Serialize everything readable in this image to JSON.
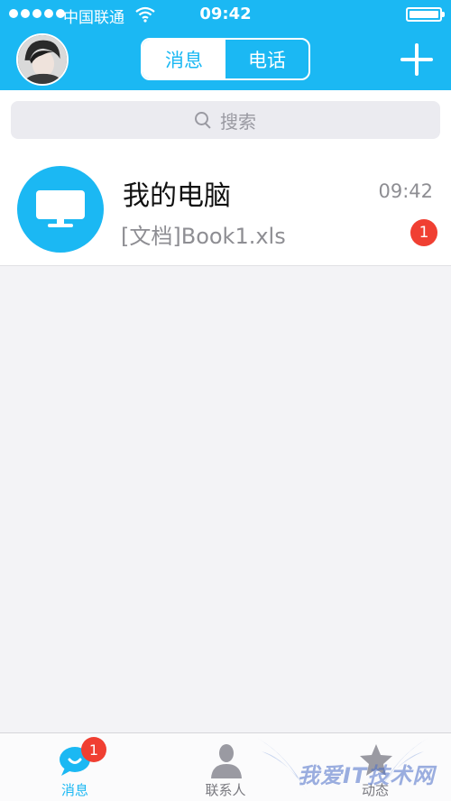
{
  "status_bar": {
    "carrier": "中国联通",
    "time": "09:42"
  },
  "header": {
    "tabs": [
      {
        "label": "消息",
        "active": true
      },
      {
        "label": "电话",
        "active": false
      }
    ],
    "accent_color": "#1bb8f3"
  },
  "search": {
    "placeholder": "搜索"
  },
  "conversations": [
    {
      "name": "我的电脑",
      "preview": "[文档]Book1.xls",
      "time": "09:42",
      "unread": "1",
      "icon": "monitor-icon"
    }
  ],
  "tabbar": {
    "items": [
      {
        "label": "消息",
        "badge": "1",
        "icon": "chat-bubble-icon"
      },
      {
        "label": "联系人",
        "icon": "person-icon"
      },
      {
        "label": "动态",
        "icon": "star-icon"
      }
    ]
  },
  "watermark": {
    "text": "我爱IT技术网"
  }
}
